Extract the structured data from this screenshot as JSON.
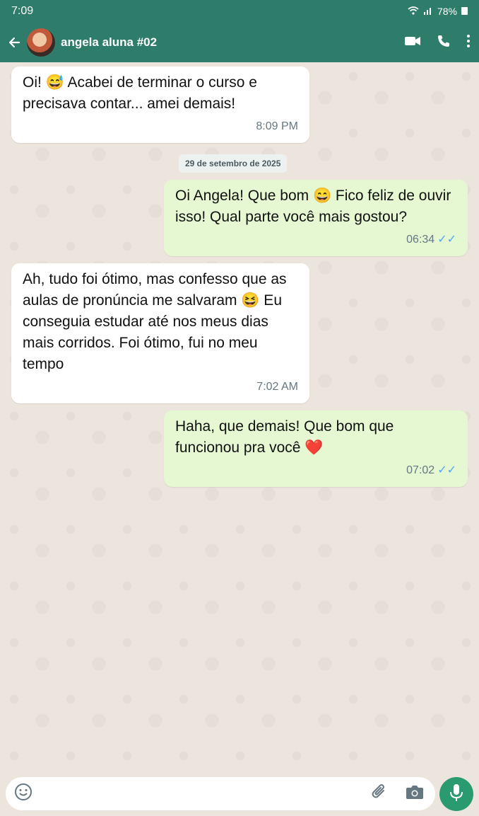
{
  "status": {
    "time": "7:09",
    "battery": "78%"
  },
  "header": {
    "contact_name": "angela aluna #02"
  },
  "messages": [
    {
      "direction": "in",
      "text": "Oi! 😅 Acabei de terminar o curso e precisava contar... amei demais!",
      "time": "8:09 PM"
    },
    {
      "direction": "out",
      "text": "Oi Angela! Que bom 😄 Fico feliz de ouvir isso! Qual parte você mais gostou?",
      "time": "06:34",
      "ticks": "✓✓"
    },
    {
      "direction": "in",
      "text": "Ah, tudo foi ótimo, mas confesso que as aulas de pronúncia me salvaram 😆 Eu conseguia estudar até nos meus dias mais corridos. Foi ótimo, fui no meu tempo",
      "time": "7:02 AM"
    },
    {
      "direction": "out",
      "text": "Haha, que demais! Que bom que funcionou pra você ❤️",
      "time": "07:02",
      "ticks": "✓✓"
    }
  ],
  "date_separator": "29 de setembro de 2025",
  "composer": {
    "placeholder": ""
  },
  "icons": {
    "back": "arrow-left-icon",
    "video": "video-call-icon",
    "call": "phone-icon",
    "menu": "more-vert-icon",
    "emoji": "emoji-icon",
    "attach": "paperclip-icon",
    "camera": "camera-icon",
    "mic": "mic-icon"
  },
  "colors": {
    "header": "#2E7D6A",
    "outgoing_bubble": "#E5F8D2",
    "incoming_bubble": "#FFFFFF",
    "chat_bg": "#ECE5DD",
    "mic_button": "#2A9B70",
    "read_ticks": "#53A6F4"
  }
}
